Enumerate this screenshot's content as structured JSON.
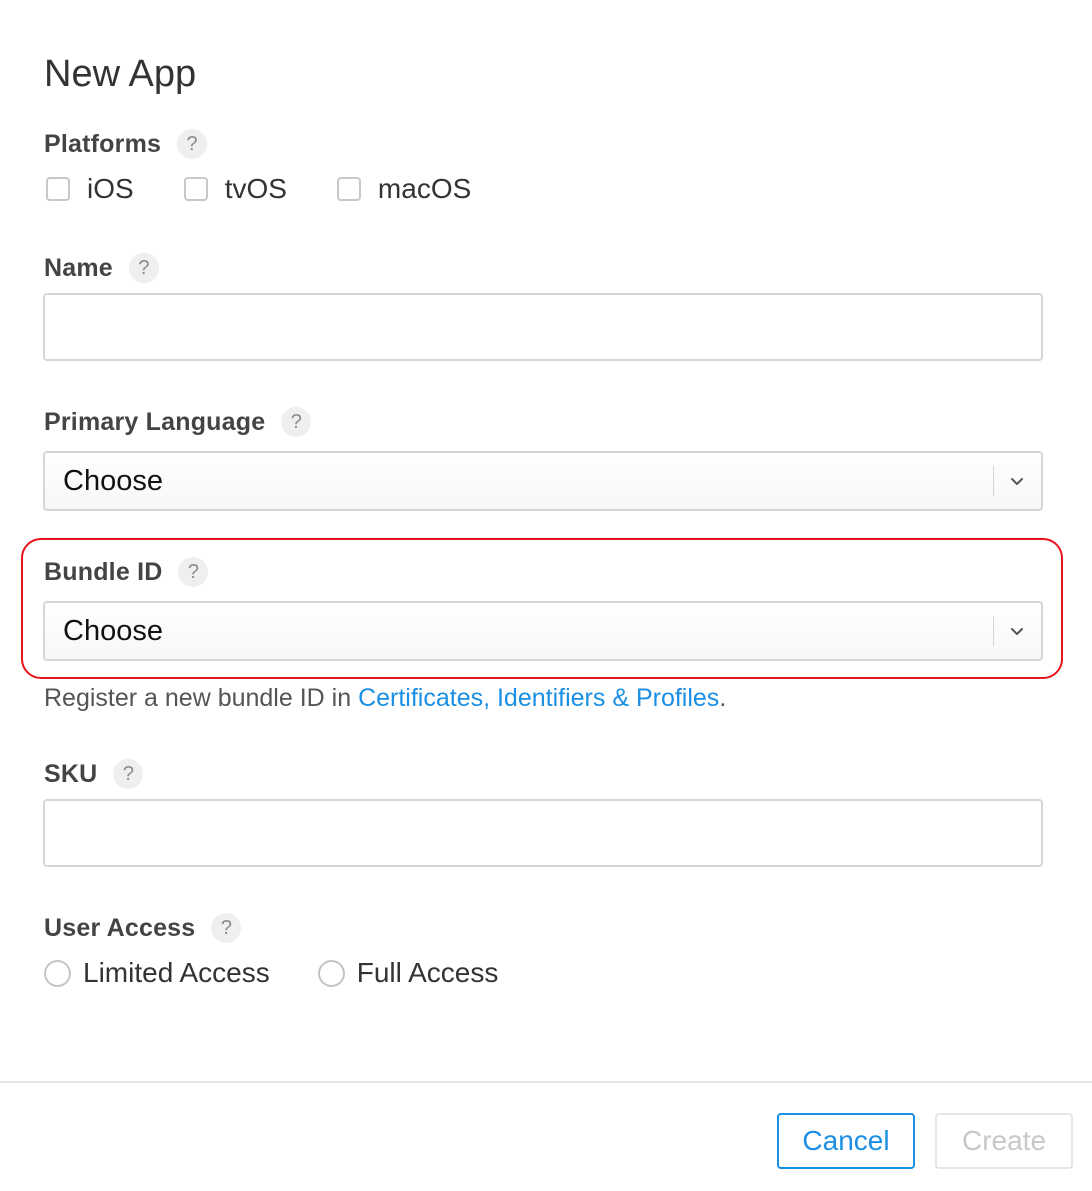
{
  "dialog": {
    "title": "New App"
  },
  "platforms": {
    "label": "Platforms",
    "help": "?",
    "options": [
      {
        "label": "iOS",
        "checked": false
      },
      {
        "label": "tvOS",
        "checked": false
      },
      {
        "label": "macOS",
        "checked": false
      }
    ]
  },
  "name": {
    "label": "Name",
    "help": "?",
    "value": "",
    "placeholder": ""
  },
  "primary_language": {
    "label": "Primary Language",
    "help": "?",
    "selected": "Choose"
  },
  "bundle_id": {
    "label": "Bundle ID",
    "help": "?",
    "selected": "Choose",
    "hint_prefix": "Register a new bundle ID in ",
    "hint_link": "Certificates, Identifiers & Profiles",
    "hint_suffix": "."
  },
  "sku": {
    "label": "SKU",
    "help": "?",
    "value": "",
    "placeholder": ""
  },
  "user_access": {
    "label": "User Access",
    "help": "?",
    "options": [
      {
        "label": "Limited Access",
        "selected": false
      },
      {
        "label": "Full Access",
        "selected": false
      }
    ]
  },
  "footer": {
    "cancel_label": "Cancel",
    "create_label": "Create"
  },
  "colors": {
    "accent": "#1a8fe3",
    "highlight": "#e8141c",
    "disabled": "#c8c8c8"
  }
}
